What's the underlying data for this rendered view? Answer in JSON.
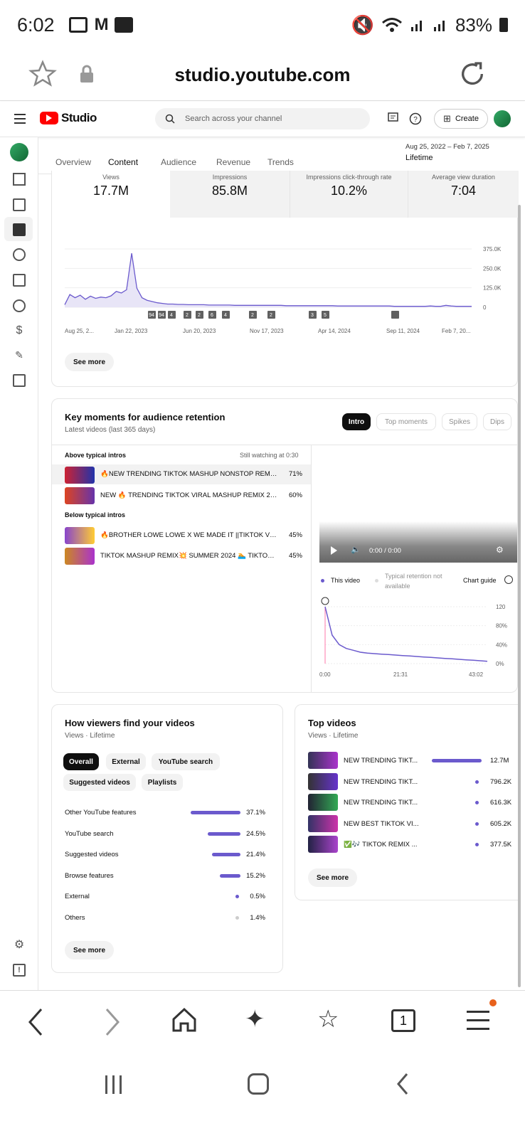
{
  "status": {
    "time": "6:02",
    "battery": "83%"
  },
  "browser": {
    "url": "studio.youtube.com"
  },
  "header": {
    "brand": "Studio",
    "search_placeholder": "Search across your channel",
    "create": "Create"
  },
  "tabs": [
    "Overview",
    "Content",
    "Audience",
    "Revenue",
    "Trends"
  ],
  "date_range": {
    "range": "Aug 25, 2022 – Feb 7, 2025",
    "label": "Lifetime"
  },
  "metrics": [
    {
      "label": "Views",
      "value": "17.7M"
    },
    {
      "label": "Impressions",
      "value": "85.8M"
    },
    {
      "label": "Impressions click-through rate",
      "value": "10.2%"
    },
    {
      "label": "Average view duration",
      "value": "7:04"
    }
  ],
  "chart_data": {
    "type": "area",
    "x_ticks": [
      "Aug 25, 2...",
      "Jan 22, 2023",
      "Jun 20, 2023",
      "Nov 17, 2023",
      "Apr 14, 2024",
      "Sep 11, 2024",
      "Feb 7, 20..."
    ],
    "y_ticks": [
      "375.0K",
      "250.0K",
      "125.0K",
      "0"
    ],
    "markers": [
      "94",
      "94",
      "4",
      "2",
      "2",
      "6",
      "4",
      "2",
      "2",
      "3",
      "5"
    ],
    "values": [
      8,
      40,
      30,
      38,
      25,
      35,
      28,
      32,
      30,
      36,
      50,
      45,
      55,
      170,
      60,
      30,
      22,
      18,
      14,
      12,
      10,
      10,
      9,
      9,
      8,
      8,
      8,
      8,
      7,
      7,
      7,
      7,
      7,
      6,
      6,
      6,
      6,
      6,
      6,
      6,
      6,
      6,
      6,
      5,
      5,
      5,
      5,
      5,
      5,
      5,
      5,
      5,
      5,
      4,
      4,
      4,
      4,
      4,
      4,
      4,
      4,
      4,
      4,
      4,
      3,
      3,
      3,
      3,
      3,
      3,
      3,
      4,
      3,
      3,
      6,
      4,
      3,
      3,
      3,
      3
    ]
  },
  "see_more": "See more",
  "retention": {
    "title": "Key moments for audience retention",
    "subtitle": "Latest videos (last 365 days)",
    "pills": [
      "Intro",
      "Top moments",
      "Spikes",
      "Dips"
    ],
    "above_label": "Above typical intros",
    "still_watching": "Still watching at 0:30",
    "below_label": "Below typical intros",
    "above": [
      {
        "title": "🔥NEW TRENDING TIKTOK MASHUP NONSTOP REMIX 2...",
        "pct": "71%"
      },
      {
        "title": "NEW 🔥 TRENDING TIKTOK VIRAL MASHUP REMIX 2024...",
        "pct": "60%"
      }
    ],
    "below": [
      {
        "title": "🔥BROTHER LOWE LOWE X WE MADE IT ||TIKTOK VIRAL...",
        "pct": "45%"
      },
      {
        "title": "TIKTOK MASHUP REMIX💥 SUMMER 2024 🏊 TIKTOK N...",
        "pct": "45%"
      }
    ],
    "player_time": "0:00 / 0:00",
    "legend_this": "This video",
    "legend_typical": "Typical retention not available",
    "chart_guide": "Chart guide",
    "ret_y": [
      "120",
      "80%",
      "40%",
      "0%"
    ],
    "ret_x": [
      "0:00",
      "21:31",
      "43:02"
    ]
  },
  "traffic": {
    "title": "How viewers find your videos",
    "subtitle": "Views · Lifetime",
    "pills": [
      "Overall",
      "External",
      "YouTube search",
      "Suggested videos",
      "Playlists"
    ],
    "rows": [
      {
        "label": "Other YouTube features",
        "pct": "37.1%",
        "value": 37.1
      },
      {
        "label": "YouTube search",
        "pct": "24.5%",
        "value": 24.5
      },
      {
        "label": "Suggested videos",
        "pct": "21.4%",
        "value": 21.4
      },
      {
        "label": "Browse features",
        "pct": "15.2%",
        "value": 15.2
      },
      {
        "label": "External",
        "pct": "0.5%",
        "value": 0.5
      },
      {
        "label": "Others",
        "pct": "1.4%",
        "value": 1.4
      }
    ]
  },
  "top": {
    "title": "Top videos",
    "subtitle": "Views · Lifetime",
    "rows": [
      {
        "title": "NEW TRENDING TIKT...",
        "views": "12.7M",
        "value": 12.7
      },
      {
        "title": "NEW TRENDING TIKT...",
        "views": "796.2K",
        "value": 0.7962
      },
      {
        "title": "NEW TRENDING TIKT...",
        "views": "616.3K",
        "value": 0.6163
      },
      {
        "title": "NEW BEST TIKTOK VI...",
        "views": "605.2K",
        "value": 0.6052
      },
      {
        "title": "✅🎶 TIKTOK REMIX ...",
        "views": "377.5K",
        "value": 0.3775
      }
    ]
  }
}
